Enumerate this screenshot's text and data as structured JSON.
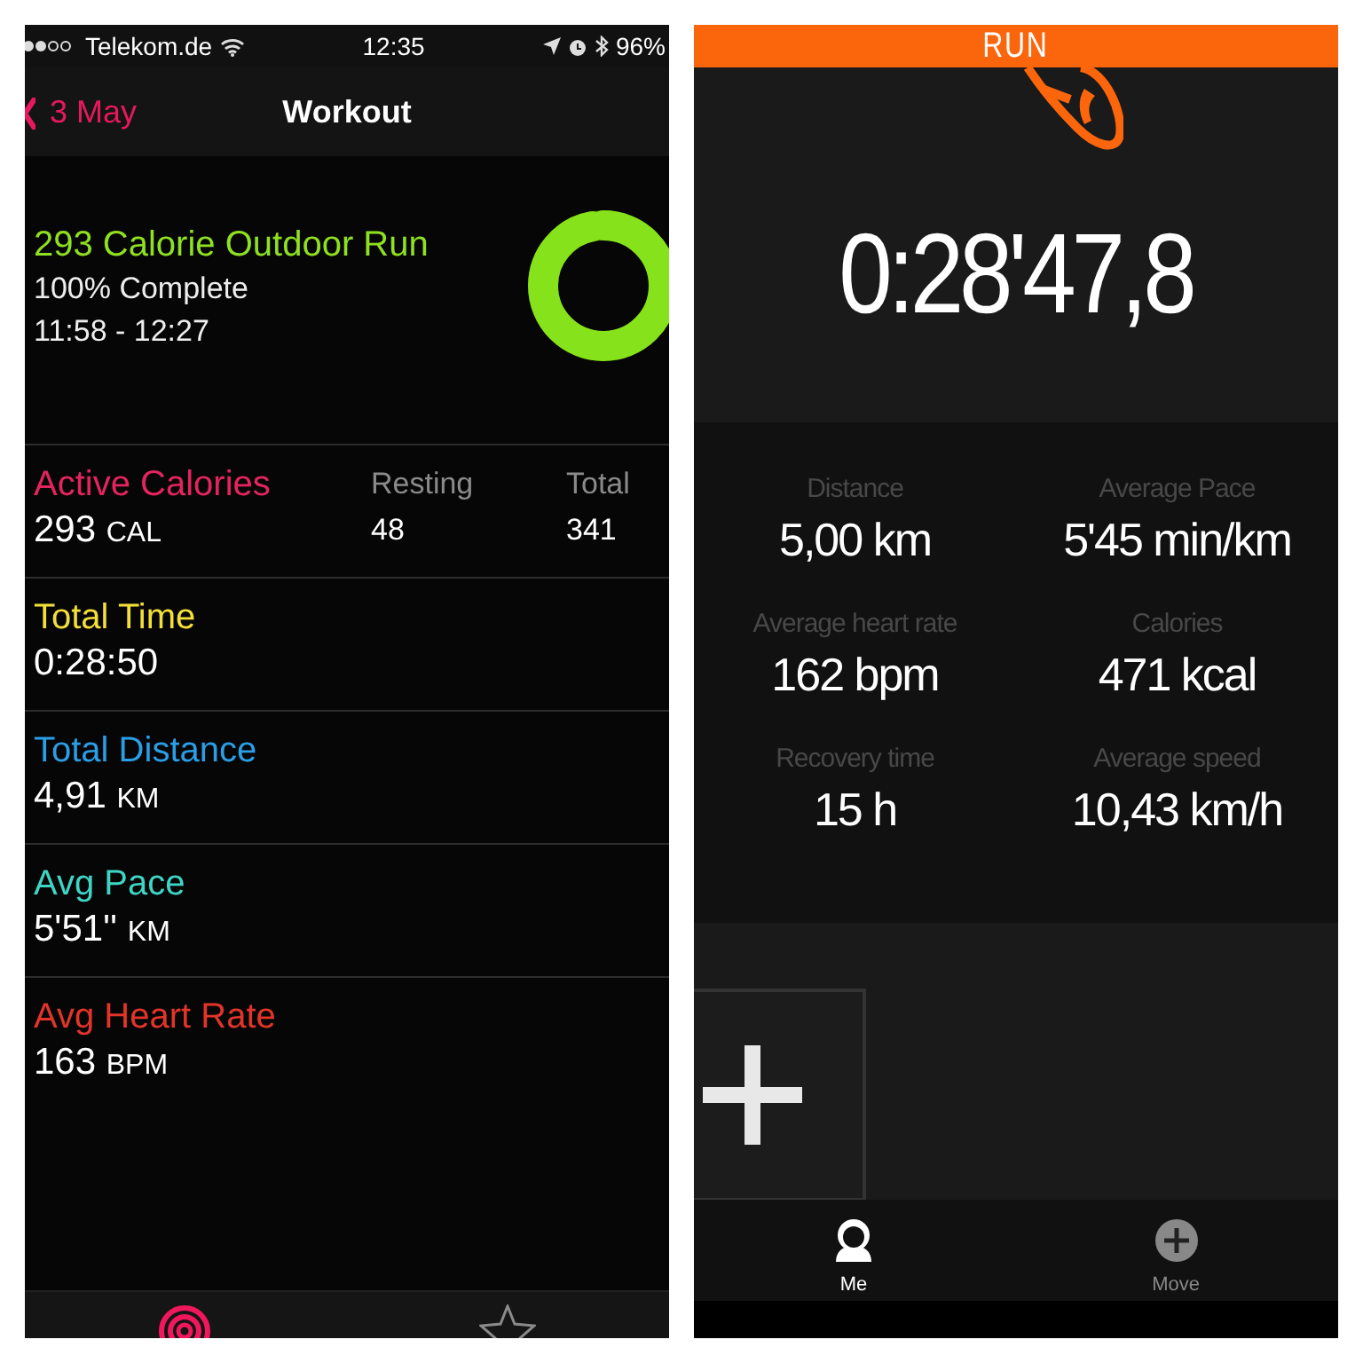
{
  "left_screen": {
    "status_bar": {
      "carrier": "Telekom.de",
      "time": "12:35",
      "battery": "96%"
    },
    "nav_bar": {
      "back": "3 May",
      "title": "Workout"
    },
    "summary": {
      "title": "293 Calorie Outdoor Run",
      "progress": "100% Complete",
      "time_range": "11:58 - 12:27"
    },
    "calories": {
      "label": "Active Calories",
      "value": "293",
      "unit": "CAL",
      "resting_label": "Resting",
      "resting_value": "48",
      "total_label": "Total",
      "total_value": "341"
    },
    "metrics": [
      {
        "label": "Total Time",
        "value": "0:28:50",
        "color": "#f2df3a"
      },
      {
        "label": "Total Distance",
        "value": "4,91",
        "unit": "KM",
        "color": "#2a9ee6"
      },
      {
        "label": "Avg Pace",
        "value": "5'51''",
        "unit": "KM",
        "color": "#3fd5c5"
      },
      {
        "label": "Avg Heart Rate",
        "value": "163",
        "unit": "BPM",
        "color": "#e3342a"
      }
    ],
    "tab_bar": [
      {
        "kind": "activity",
        "selected": true
      },
      {
        "kind": "achievements",
        "selected": false
      }
    ]
  },
  "right_screen": {
    "header": "RUN",
    "duration": "0:28'47,8",
    "stats": [
      {
        "label": "Distance",
        "value": "5,00 km"
      },
      {
        "label": "Average Pace",
        "value": "5'45 min/km"
      },
      {
        "label": "Average heart rate",
        "value": "162 bpm"
      },
      {
        "label": "Calories",
        "value": "471 kcal"
      },
      {
        "label": "Recovery time",
        "value": "15 h"
      },
      {
        "label": "Average speed",
        "value": "10,43 km/h"
      }
    ],
    "tab_bar": [
      {
        "kind": "me",
        "label": "Me",
        "selected": true
      },
      {
        "kind": "move",
        "label": "Move",
        "selected": false
      }
    ]
  }
}
